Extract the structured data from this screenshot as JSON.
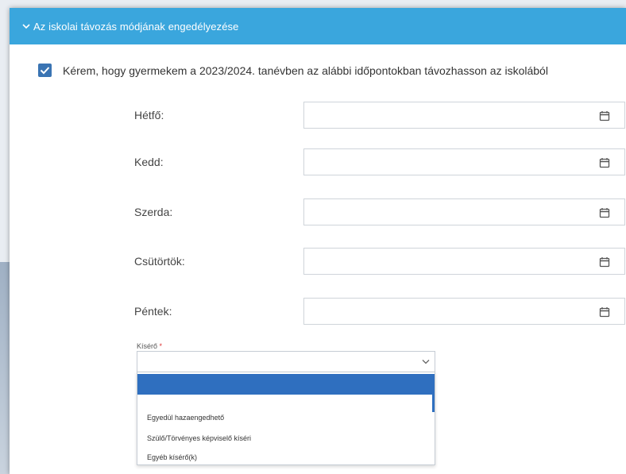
{
  "section": {
    "title": "Az iskolai távozás módjának engedélyezése",
    "header_color": "#3aa6dd"
  },
  "consent": {
    "checked": true,
    "text": "Kérem, hogy gyermekem a 2023/2024. tanévben az alábbi időpontokban távozhasson az iskolából"
  },
  "days": [
    {
      "label": "Hétfő:",
      "value": ""
    },
    {
      "label": "Kedd:",
      "value": ""
    },
    {
      "label": "Szerda:",
      "value": ""
    },
    {
      "label": "Csütörtök:",
      "value": ""
    },
    {
      "label": "Péntek:",
      "value": ""
    }
  ],
  "kisero": {
    "label": "Kísérő",
    "required_mark": "*",
    "value": "",
    "options": [
      "",
      "Egyedül hazaengedhető",
      "Szülő/Törvényes képviselő kíséri",
      "Egyéb kísérő(k)"
    ],
    "highlight_color": "#2f6fbf"
  },
  "icons": {
    "header_toggle": "chevron-down-icon",
    "date_picker": "calendar-icon",
    "select_toggle": "chevron-down-icon",
    "checkbox": "checkmark-icon"
  }
}
